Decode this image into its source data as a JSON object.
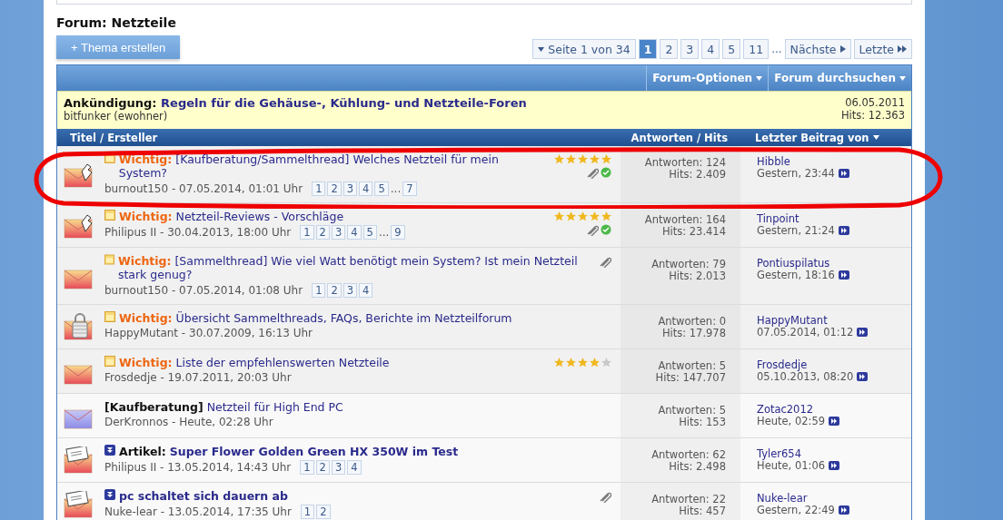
{
  "forum_title": "Forum: Netzteile",
  "new_thread_button": "+ Thema erstellen",
  "pagination": {
    "label": "Seite 1 von 34",
    "pages": [
      {
        "label": "1",
        "selected": true
      },
      {
        "label": "2",
        "selected": false
      },
      {
        "label": "3",
        "selected": false
      },
      {
        "label": "4",
        "selected": false
      },
      {
        "label": "5",
        "selected": false
      },
      {
        "label": "11",
        "selected": false
      }
    ],
    "gap": "...",
    "next": "Nächste",
    "last": "Letzte"
  },
  "toolbar": {
    "menus": [
      "Forum-Optionen",
      "Forum durchsuchen"
    ]
  },
  "announcement": {
    "prefix": "Ankündigung:",
    "title": "Regeln für die Gehäuse-, Kühlung- und Netzteile-Foren",
    "author": "bitfunker (ewohner)",
    "date": "06.05.2011",
    "hits": "Hits: 12.363"
  },
  "columns": {
    "title": "Titel / Ersteller",
    "stats": "Antworten / Hits",
    "last_post": "Letzter Beitrag von"
  },
  "threads": [
    {
      "kind": "sticky",
      "hot": true,
      "locked": false,
      "new": false,
      "prefix": "Wichtig:",
      "title": "[Kaufberatung/Sammelthread] Welches Netzteil für mein System?",
      "meta": "burnout150 - 07.05.2014, 01:01 Uhr",
      "pages": [
        "1",
        "2",
        "3",
        "4",
        "5"
      ],
      "page_gap": "...",
      "last_page": "7",
      "stars": 5,
      "attachment": true,
      "solved": true,
      "replies": "Antworten: 124",
      "hits": "Hits: 2.409",
      "last_user": "Hibble",
      "last_time": "Gestern, 23:44"
    },
    {
      "kind": "sticky",
      "hot": true,
      "locked": false,
      "new": false,
      "prefix": "Wichtig:",
      "title": "Netzteil-Reviews - Vorschläge",
      "meta": "Philipus II - 30.04.2013, 18:00 Uhr",
      "pages": [
        "1",
        "2",
        "3",
        "4",
        "5"
      ],
      "page_gap": "...",
      "last_page": "9",
      "stars": 5,
      "attachment": true,
      "solved": true,
      "replies": "Antworten: 164",
      "hits": "Hits: 23.414",
      "last_user": "Tinpoint",
      "last_time": "Gestern, 21:24"
    },
    {
      "kind": "sticky",
      "hot": false,
      "locked": false,
      "new": false,
      "prefix": "Wichtig:",
      "title": "[Sammelthread] Wie viel Watt benötigt mein System? Ist mein Netzteil stark genug?",
      "meta": "burnout150 - 07.05.2014, 01:08 Uhr",
      "pages": [
        "1",
        "2",
        "3",
        "4"
      ],
      "attachment": true,
      "solved": false,
      "replies": "Antworten: 79",
      "hits": "Hits: 2.013",
      "last_user": "Pontiuspilatus",
      "last_time": "Gestern, 18:16"
    },
    {
      "kind": "sticky",
      "hot": false,
      "locked": true,
      "new": false,
      "prefix": "Wichtig:",
      "title": "Übersicht Sammelthreads, FAQs, Berichte im Netzteilforum",
      "meta": "HappyMutant - 30.07.2009, 16:13 Uhr",
      "attachment": false,
      "solved": false,
      "replies": "Antworten: 0",
      "hits": "Hits: 17.978",
      "last_user": "HappyMutant",
      "last_time": "07.05.2014, 01:12"
    },
    {
      "kind": "sticky",
      "hot": false,
      "locked": false,
      "new": false,
      "prefix": "Wichtig:",
      "title": "Liste der empfehlenswerten Netzteile",
      "meta": "Frosdedje - 19.07.2011, 20:03 Uhr",
      "stars": 4,
      "attachment": false,
      "solved": false,
      "replies": "Antworten: 5",
      "hits": "Hits: 147.707",
      "last_user": "Frosdedje",
      "last_time": "05.10.2013, 08:20"
    },
    {
      "kind": "normal",
      "hot": false,
      "locked": false,
      "new": true,
      "prefix": "[Kaufberatung]",
      "title": "Netzteil für High End PC",
      "meta": "DerKronnos - Heute, 02:28 Uhr",
      "attachment": false,
      "solved": false,
      "replies": "Antworten: 5",
      "hits": "Hits: 153",
      "last_user": "Zotac2012",
      "last_time": "Heute, 02:59"
    },
    {
      "kind": "article",
      "hot": false,
      "locked": false,
      "new": false,
      "prefix": "Artikel:",
      "title": "Super Flower Golden Green HX 350W im Test",
      "meta": "Philipus II - 13.05.2014, 14:43 Uhr",
      "pages": [
        "1",
        "2",
        "3",
        "4"
      ],
      "attachment": false,
      "solved": false,
      "replies": "Antworten: 62",
      "hits": "Hits: 2.498",
      "last_user": "Tyler654",
      "last_time": "Heute, 01:06"
    },
    {
      "kind": "article",
      "hot": false,
      "locked": false,
      "new": false,
      "title": "pc schaltet sich dauern ab",
      "meta": "Nuke-lear - 13.05.2014, 17:35 Uhr",
      "pages": [
        "1",
        "2"
      ],
      "attachment": true,
      "solved": false,
      "replies": "Antworten: 22",
      "hits": "Hits: 457",
      "last_user": "Nuke-lear",
      "last_time": "Gestern, 22:49"
    }
  ]
}
